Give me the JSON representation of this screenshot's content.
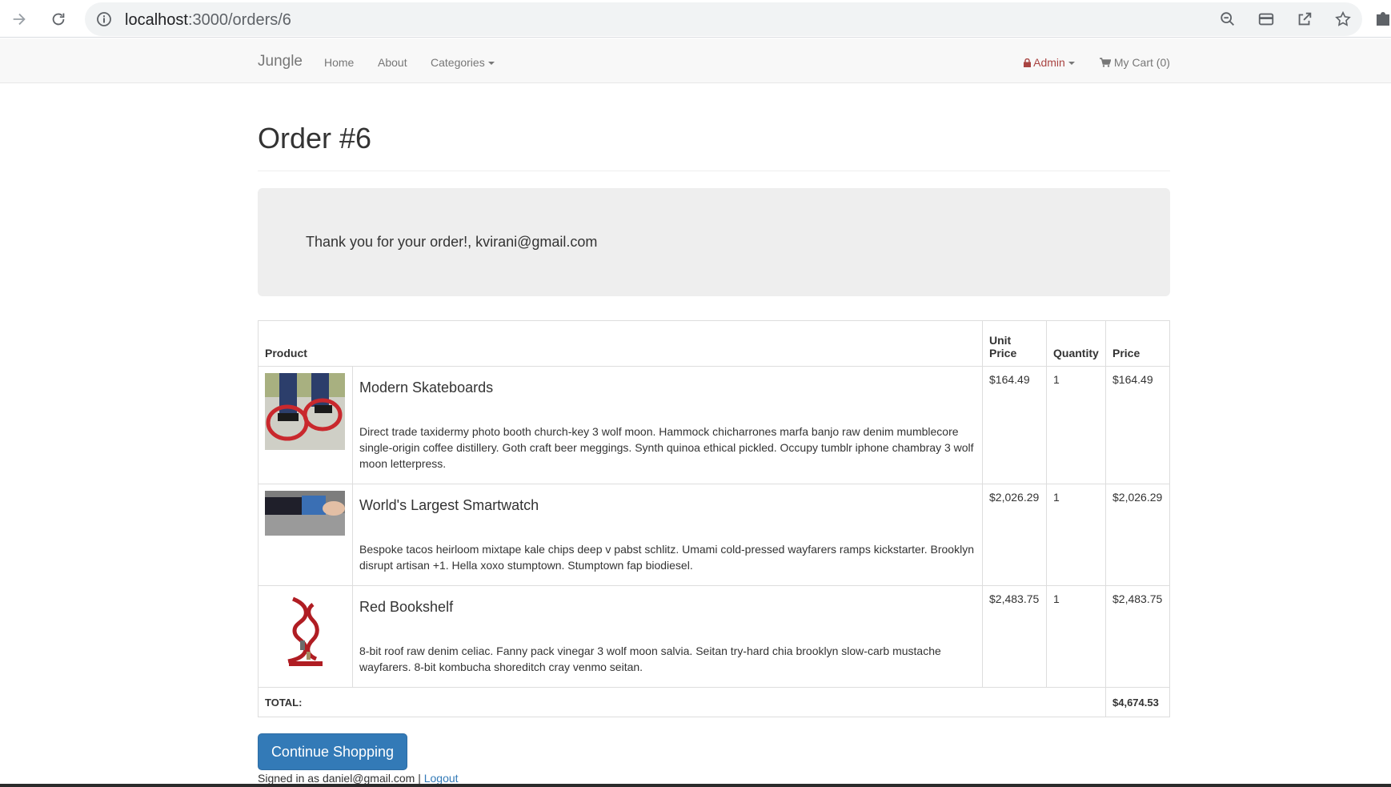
{
  "browser": {
    "url_host": "localhost",
    "url_path": ":3000/orders/6"
  },
  "nav": {
    "brand": "Jungle",
    "links": [
      "Home",
      "About",
      "Categories"
    ],
    "admin": "Admin",
    "cart": "My Cart (0)"
  },
  "page": {
    "title": "Order #6",
    "thank_you": "Thank you for your order!, kvirani@gmail.com"
  },
  "table": {
    "headers": {
      "product": "Product",
      "unit_price": "Unit Price",
      "quantity": "Quantity",
      "price": "Price"
    },
    "rows": [
      {
        "name": "Modern Skateboards",
        "description": "Direct trade taxidermy photo booth church-key 3 wolf moon. Hammock chicharrones marfa banjo raw denim mumblecore single-origin coffee distillery. Goth craft beer meggings. Synth quinoa ethical pickled. Occupy tumblr iphone chambray 3 wolf moon letterpress.",
        "unit_price": "$164.49",
        "quantity": "1",
        "price": "$164.49"
      },
      {
        "name": "World's Largest Smartwatch",
        "description": "Bespoke tacos heirloom mixtape kale chips deep v pabst schlitz. Umami cold-pressed wayfarers ramps kickstarter. Brooklyn disrupt artisan +1. Hella xoxo stumptown. Stumptown fap biodiesel.",
        "unit_price": "$2,026.29",
        "quantity": "1",
        "price": "$2,026.29"
      },
      {
        "name": "Red Bookshelf",
        "description": "8-bit roof raw denim celiac. Fanny pack vinegar 3 wolf moon salvia. Seitan try-hard chia brooklyn slow-carb mustache wayfarers. 8-bit kombucha shoreditch cray venmo seitan.",
        "unit_price": "$2,483.75",
        "quantity": "1",
        "price": "$2,483.75"
      }
    ],
    "total_label": "TOTAL:",
    "total_value": "$4,674.53"
  },
  "actions": {
    "continue": "Continue Shopping"
  },
  "footer": {
    "signed_in": "Signed in as daniel@gmail.com |",
    "logout": "Logout"
  },
  "colors": {
    "primary": "#337ab7",
    "admin": "#a94442",
    "jumbotron": "#eeeeee"
  }
}
